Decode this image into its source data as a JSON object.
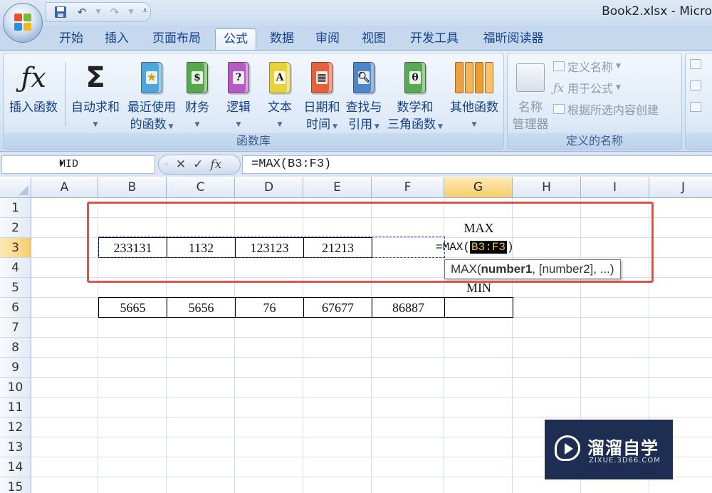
{
  "window": {
    "title": "Book2.xlsx - Micro"
  },
  "qat": {
    "save_icon": "save-icon",
    "undo_icon": "undo-icon",
    "redo_icon": "redo-icon",
    "customize_icon": "customize-qat-icon"
  },
  "tabs": [
    "开始",
    "插入",
    "页面布局",
    "公式",
    "数据",
    "审阅",
    "视图",
    "开发工具",
    "福昕阅读器"
  ],
  "active_tab": "公式",
  "ribbon": {
    "function_library": {
      "label": "函数库",
      "insert_function": "插入函数",
      "autosum": "自动求和",
      "recent_1": "最近使用",
      "recent_2": "的函数",
      "financial": "财务",
      "logical": "逻辑",
      "text": "文本",
      "datetime_1": "日期和",
      "datetime_2": "时间",
      "lookup_1": "查找与",
      "lookup_2": "引用",
      "math_1": "数学和",
      "math_2": "三角函数",
      "more": "其他函数"
    },
    "defined_names": {
      "label": "定义的名称",
      "name_manager_1": "名称",
      "name_manager_2": "管理器",
      "define_name": "定义名称",
      "use_in_formula": "用于公式",
      "create_from_selection": "根据所选内容创建"
    }
  },
  "formula_bar": {
    "name_box": "MID",
    "formula": "=MAX(B3:F3)",
    "fx": "fx"
  },
  "grid": {
    "columns": [
      "A",
      "B",
      "C",
      "D",
      "E",
      "F",
      "G",
      "H",
      "I",
      "J"
    ],
    "rows": [
      "1",
      "2",
      "3",
      "4",
      "5",
      "6",
      "7",
      "8",
      "9",
      "10",
      "11",
      "12",
      "13",
      "14",
      "15"
    ],
    "G2": "MAX",
    "row3": [
      "233131",
      "1132",
      "123123",
      "21213"
    ],
    "G5": "MIN",
    "row6": [
      "5665",
      "5656",
      "76",
      "67677",
      "86887"
    ],
    "edit_prefix": "=MAX(",
    "edit_ref": "B3:F3",
    "edit_suffix": ")"
  },
  "tooltip": {
    "fn": "MAX(",
    "arg1": "number1",
    "rest": ", [number2], ...)"
  },
  "watermark": {
    "title": "溜溜自学",
    "subtitle": "ZIXUE.3D66.COM"
  }
}
